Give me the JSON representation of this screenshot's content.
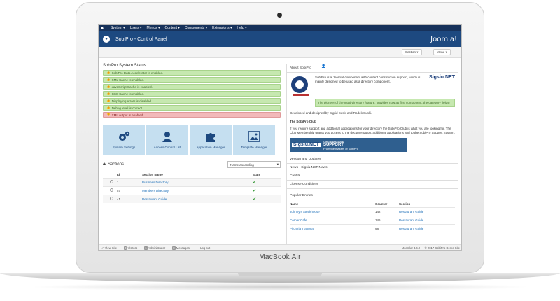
{
  "device": {
    "brand": "MacBook Air"
  },
  "topnav": {
    "menus": [
      "System ▾",
      "Users ▾",
      "Menus ▾",
      "Content ▾",
      "Components ▾",
      "Extensions ▾",
      "Help ▾"
    ],
    "site": "SobiPro Demo S...",
    "user": "👤 ▾"
  },
  "header": {
    "title": "SobiPro - Control Panel",
    "brand": "Joomla!"
  },
  "toolbar": {
    "section_label": "Section ▾",
    "menu_label": "Menu ▾"
  },
  "status": {
    "title": "SobiPro System Status",
    "items": [
      {
        "text": "SobiPro Data Accelerator is enabled.",
        "state": "ok"
      },
      {
        "text": "XML Cache is enabled.",
        "state": "ok"
      },
      {
        "text": "JavaScript Cache is enabled.",
        "state": "ok"
      },
      {
        "text": "CSS Cache is enabled.",
        "state": "ok"
      },
      {
        "text": "Displaying errors is disabled.",
        "state": "ok"
      },
      {
        "text": "Debug level is correct.",
        "state": "ok"
      },
      {
        "text": "XML output is enabled.",
        "state": "bad"
      }
    ]
  },
  "tiles": [
    {
      "label": "System Settings",
      "icon": "gears-icon"
    },
    {
      "label": "Access Control List",
      "icon": "user-icon"
    },
    {
      "label": "Application Manager",
      "icon": "puzzle-icon"
    },
    {
      "label": "Template Manager",
      "icon": "image-icon"
    }
  ],
  "sections": {
    "title": "Sections",
    "sort_select": "Name ascending",
    "columns": [
      "",
      "Id",
      "Section Name",
      "State"
    ],
    "rows": [
      {
        "id": "1",
        "name": "Business Directory"
      },
      {
        "id": "57",
        "name": "Members Directory"
      },
      {
        "id": "41",
        "name": "Restaurant Guide"
      }
    ]
  },
  "about": {
    "title": "About SobiPro",
    "text": "SobiPro is a Joomla! component with content construction support, which is mainly designed to be used as a directory component.",
    "note": "The pioneer of the multi-directory feature, provides now as first component, the category fields!",
    "credits": "Developed and designed by Sigrid Suski and Radek Suski.",
    "club_title": "The SobiPro Club",
    "club_text": "If you require support and additional applications for your directory the SobiPro Club is what you are looking for. The Club Membership grants you access to the documentation, additional applications and to the SobiPro Support System.",
    "logo_text": "Sigsiu.NET",
    "banner_logo": "Sigsiu.NET",
    "banner_line1": "Get professional",
    "banner_line2": "SUPPORT",
    "banner_line3": "From the makers of SobiPro"
  },
  "panels": [
    "Version and Updates",
    "News - Sigsiu.NET News",
    "Credits",
    "License Conditions"
  ],
  "popular": {
    "title": "Popular Entries",
    "columns": [
      "Name",
      "Counter",
      "Section"
    ],
    "rows": [
      {
        "name": "Johnny's Steakhouse",
        "counter": "142",
        "section": "Restaurant Guide"
      },
      {
        "name": "Corner Cafe",
        "counter": "146",
        "section": "Restaurant Guide"
      },
      {
        "name": "Pizzeria Trattoria",
        "counter": "98",
        "section": "Restaurant Guide"
      }
    ]
  },
  "statusbar": {
    "view_site": "View Site",
    "visitors": "Visitors",
    "administrator": "Administrator",
    "messages": "Messages",
    "logout": "Log out",
    "visitors_count": "0",
    "admin_count": "1",
    "messages_count": "0",
    "right": "Joomla! 3.6.0 — © 2017 SobiPro Demo Site"
  }
}
